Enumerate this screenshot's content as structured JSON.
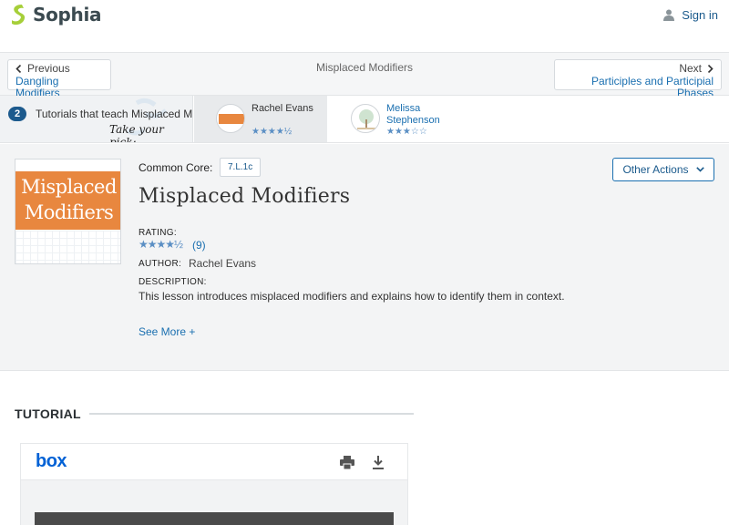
{
  "header": {
    "logo_text": "Sophia",
    "signin_label": "Sign in"
  },
  "nav": {
    "prev_small": "Previous",
    "prev_link": "Dangling Modifiers",
    "current_title": "Misplaced Modifiers",
    "next_small": "Next",
    "next_link": "Participles and Participial Phases"
  },
  "tutorials_strip": {
    "count_badge": "2",
    "text": "Tutorials that teach Misplaced M",
    "pick_text": "Take your pick:",
    "cards": [
      {
        "name": "Rachel Evans",
        "stars": "★★★★½",
        "rating": 4.5
      },
      {
        "name_line1": "Melissa",
        "name_line2": "Stephenson",
        "stars": "★★★☆☆",
        "rating": 3
      }
    ]
  },
  "lesson": {
    "cover_line1": "Misplaced",
    "cover_line2": "Modifiers",
    "common_core_label": "Common Core:",
    "common_core_code": "7.L.1c",
    "title": "Misplaced Modifiers",
    "rating_label": "RATING:",
    "rating_stars": "★★★★½",
    "rating_value": 4.5,
    "rating_count": "(9)",
    "author_label": "AUTHOR:",
    "author_name": "Rachel Evans",
    "description_label": "DESCRIPTION:",
    "description": "This lesson introduces misplaced modifiers and explains how to identify them in context.",
    "see_more": "See More +",
    "other_actions": "Other Actions"
  },
  "tutorial": {
    "heading": "TUTORIAL",
    "viewer_logo": "box",
    "icons": [
      "print-icon",
      "download-icon"
    ]
  },
  "colors": {
    "accent": "#1a6fb0",
    "brand_green": "#a6cf39",
    "cover_orange": "#e8873f",
    "box_blue": "#0061d5"
  }
}
